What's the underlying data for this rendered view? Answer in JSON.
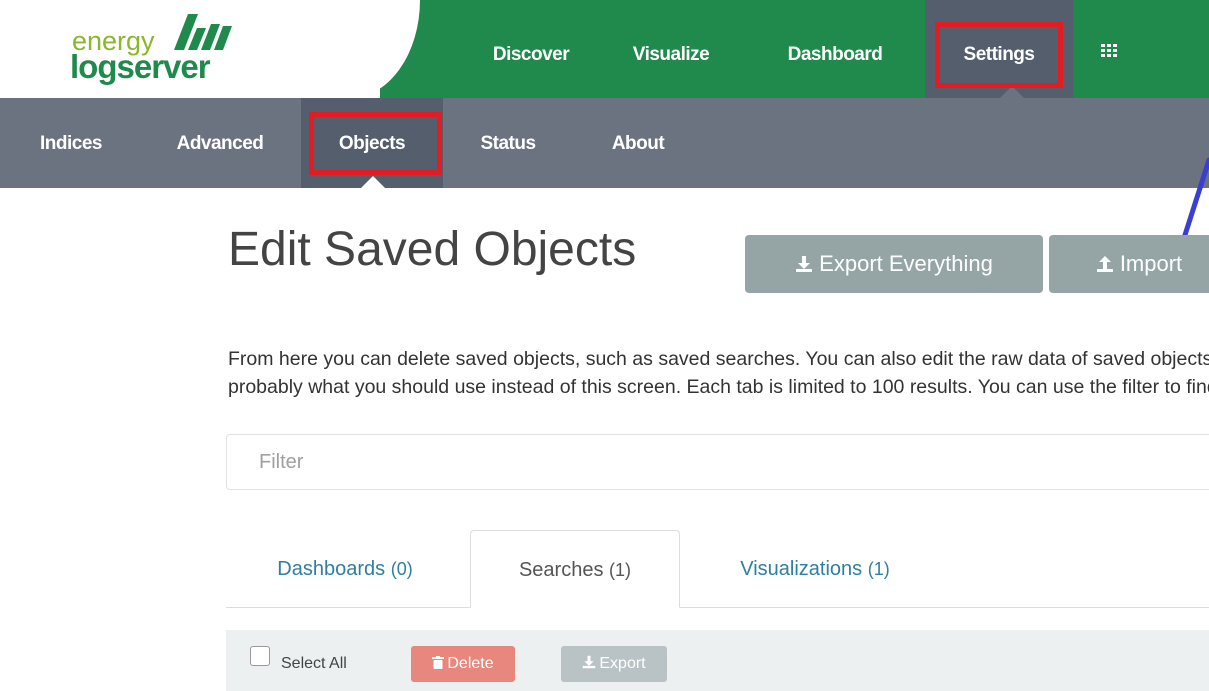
{
  "brand": {
    "logo_top": "energy",
    "logo_bottom": "logserver",
    "primary_color": "#1f8a4c",
    "accent_green": "#8ab72e"
  },
  "top_nav": {
    "items": [
      {
        "label": "Discover"
      },
      {
        "label": "Visualize"
      },
      {
        "label": "Dashboard"
      },
      {
        "label": "Settings",
        "active": true
      }
    ],
    "apps_icon": "grid-icon"
  },
  "sub_nav": {
    "items": [
      {
        "label": "Indices"
      },
      {
        "label": "Advanced"
      },
      {
        "label": "Objects",
        "active": true
      },
      {
        "label": "Status"
      },
      {
        "label": "About"
      }
    ]
  },
  "main": {
    "title": "Edit Saved Objects",
    "export_everything_label": "Export Everything",
    "import_label": "Import",
    "description_line1": "From here you can delete saved objects, such as saved searches. You can also edit the raw data of saved objects. Typically objects are only modified via their associated application, which is",
    "description_line2": "probably what you should use instead of this screen. Each tab is limited to 100 results. You can use the filter to find objects not in the default list.",
    "filter_placeholder": "Filter",
    "tabs": [
      {
        "label": "Dashboards",
        "count": "(0)"
      },
      {
        "label": "Searches",
        "count": "(1)",
        "active": true
      },
      {
        "label": "Visualizations",
        "count": "(1)"
      }
    ],
    "toolbar": {
      "select_all_label": "Select All",
      "delete_label": "Delete",
      "export_label": "Export"
    }
  },
  "colors": {
    "highlight": "#e31b23",
    "delete": "#e74c3c",
    "button_grey": "#95a5a6",
    "tab_link": "#2e7fa0"
  }
}
